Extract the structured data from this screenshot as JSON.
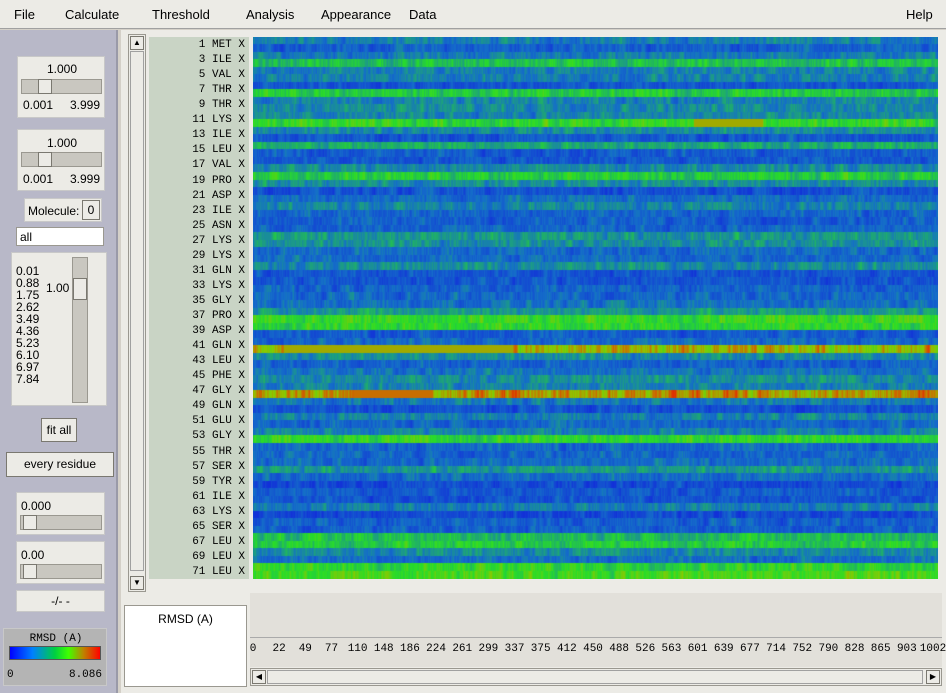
{
  "menu": {
    "file": "File",
    "calculate": "Calculate",
    "threshold": "Threshold",
    "analysis": "Analysis",
    "appearance": "Appearance",
    "data": "Data",
    "help": "Help"
  },
  "left_panel": {
    "slider1": {
      "value": "1.000",
      "min": "0.001",
      "max": "3.999"
    },
    "slider2": {
      "value": "1.000",
      "min": "0.001",
      "max": "3.999"
    },
    "molecule_label": "Molecule:",
    "molecule_value": "0",
    "selection_field": "all",
    "scale_values": [
      "0.01",
      "0.88",
      "1.75",
      "2.62",
      "3.49",
      "4.36",
      "5.23",
      "6.10",
      "6.97",
      "7.84"
    ],
    "scale_current": "1.00",
    "fit_all_button": "fit all",
    "every_residue_button": "every residue",
    "slider3_value": "0.000",
    "slider4_value": "0.00",
    "frame_readout": "-/-  -",
    "colorbar": {
      "title": "RMSD (A)",
      "min": "0",
      "max": "8.086"
    }
  },
  "residue_labels": [
    "1 MET X",
    "3 ILE X",
    "5 VAL X",
    "7 THR X",
    "9 THR X",
    "11 LYS X",
    "13 ILE X",
    "15 LEU X",
    "17 VAL X",
    "19 PRO X",
    "21 ASP X",
    "23 ILE X",
    "25 ASN X",
    "27 LYS X",
    "29 LYS X",
    "31 GLN X",
    "33 LYS X",
    "35 GLY X",
    "37 PRO X",
    "39 ASP X",
    "41 GLN X",
    "43 LEU X",
    "45 PHE X",
    "47 GLY X",
    "49 GLN X",
    "51 GLU X",
    "53 GLY X",
    "55 THR X",
    "57 SER X",
    "59 TYR X",
    "61 ILE X",
    "63 LYS X",
    "65 SER X",
    "67 LEU X",
    "69 LEU X",
    "71 LEU X"
  ],
  "bottom": {
    "plot_label": "RMSD (A)",
    "x_ticks": [
      "0",
      "22",
      "49",
      "77",
      "110",
      "148",
      "186",
      "224",
      "261",
      "299",
      "337",
      "375",
      "412",
      "450",
      "488",
      "526",
      "563",
      "601",
      "639",
      "677",
      "714",
      "752",
      "790",
      "828",
      "865",
      "903",
      "1002"
    ]
  },
  "colors": {
    "heat_low": "#1230d8",
    "heat_mid": "#18c048",
    "heat_high": "#e02000",
    "label_bg": "#c9d4c5"
  }
}
